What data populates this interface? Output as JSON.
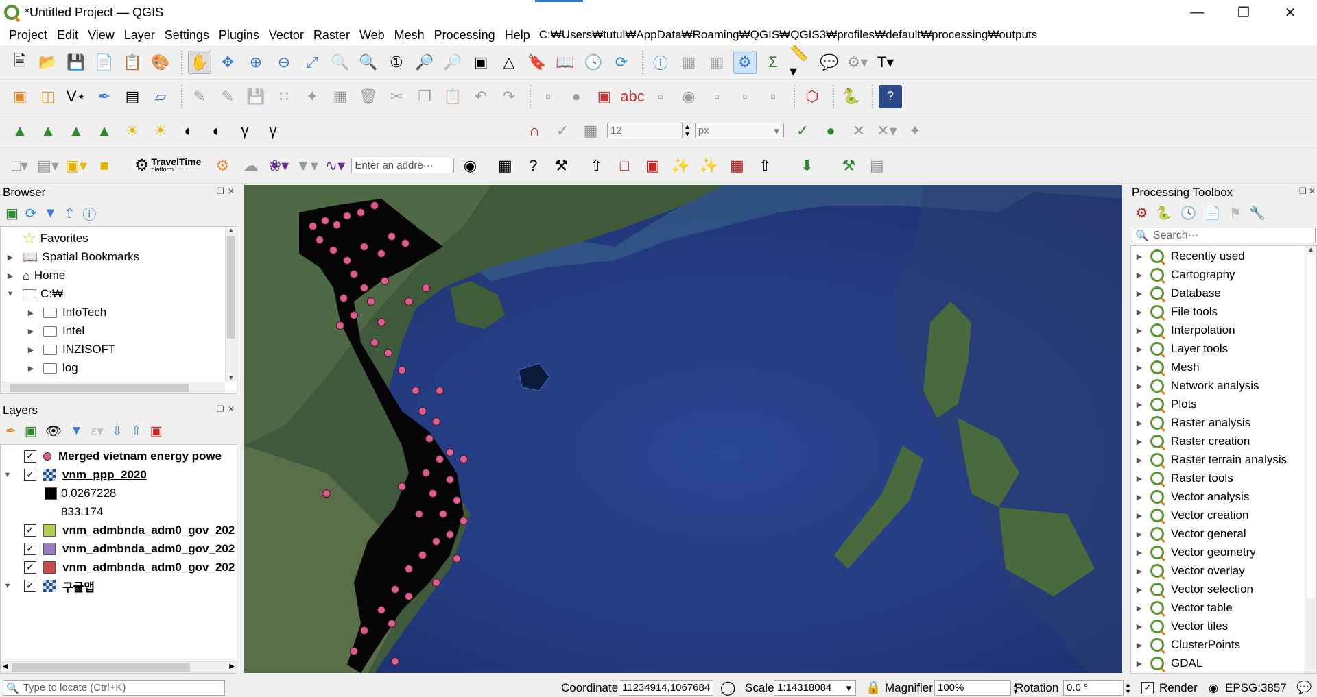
{
  "window": {
    "title": "*Untitled Project — QGIS"
  },
  "menu": {
    "items": [
      "Project",
      "Edit",
      "View",
      "Layer",
      "Settings",
      "Plugins",
      "Vector",
      "Raster",
      "Web",
      "Mesh",
      "Processing",
      "Help"
    ],
    "path": "C:₩Users₩tutul₩AppData₩Roaming₩QGIS₩QGIS3₩profiles₩default₩processing₩outputs"
  },
  "toolbar": {
    "snap_value": "12",
    "snap_unit": "px",
    "travel_time": "TravelTime",
    "travel_time_sub": "platform",
    "address_placeholder": "Enter an addre···"
  },
  "browser": {
    "title": "Browser",
    "items": [
      {
        "label": "Favorites",
        "icon": "star-icon"
      },
      {
        "label": "Spatial Bookmarks",
        "icon": "bookmark-icon"
      },
      {
        "label": "Home",
        "icon": "home-icon"
      },
      {
        "label": "C:₩",
        "icon": "drive-icon"
      },
      {
        "label": "InfoTech",
        "icon": "folder-icon"
      },
      {
        "label": "Intel",
        "icon": "folder-icon"
      },
      {
        "label": "INZISOFT",
        "icon": "folder-icon"
      },
      {
        "label": "log",
        "icon": "folder-icon"
      }
    ]
  },
  "layers": {
    "title": "Layers",
    "items": [
      {
        "label": "Merged vietnam energy powe",
        "color": "#e05c8c"
      },
      {
        "label": "vnm_ppp_2020",
        "color": "#000000"
      },
      {
        "label": "0.0267228",
        "color": "#000000"
      },
      {
        "label": "833.174",
        "color": ""
      },
      {
        "label": "vnm_admbnda_adm0_gov_202",
        "color": "#b5cc55"
      },
      {
        "label": "vnm_admbnda_adm0_gov_202",
        "color": "#9a7cc4"
      },
      {
        "label": "vnm_admbnda_adm0_gov_202",
        "color": "#c84a4a"
      },
      {
        "label": "구글맵",
        "color": ""
      }
    ]
  },
  "toolbox": {
    "title": "Processing Toolbox",
    "search_placeholder": "Search···",
    "items": [
      "Recently used",
      "Cartography",
      "Database",
      "File tools",
      "Interpolation",
      "Layer tools",
      "Mesh",
      "Network analysis",
      "Plots",
      "Raster analysis",
      "Raster creation",
      "Raster terrain analysis",
      "Raster tools",
      "Vector analysis",
      "Vector creation",
      "Vector general",
      "Vector geometry",
      "Vector overlay",
      "Vector selection",
      "Vector table",
      "Vector tiles",
      "ClusterPoints",
      "GDAL"
    ]
  },
  "statusbar": {
    "locate_placeholder": "Type to locate (Ctrl+K)",
    "coordinate_label": "Coordinate",
    "coordinate_value": "11234914,1067684",
    "scale_label": "Scale",
    "scale_value": "1:14318084",
    "magnifier_label": "Magnifier",
    "magnifier_value": "100%",
    "rotation_label": "Rotation",
    "rotation_value": "0.0 °",
    "render_label": "Render",
    "crs": "EPSG:3857"
  },
  "colors": {
    "accent": "#589632",
    "points": "#e05c8c",
    "sea": "#23397e"
  }
}
